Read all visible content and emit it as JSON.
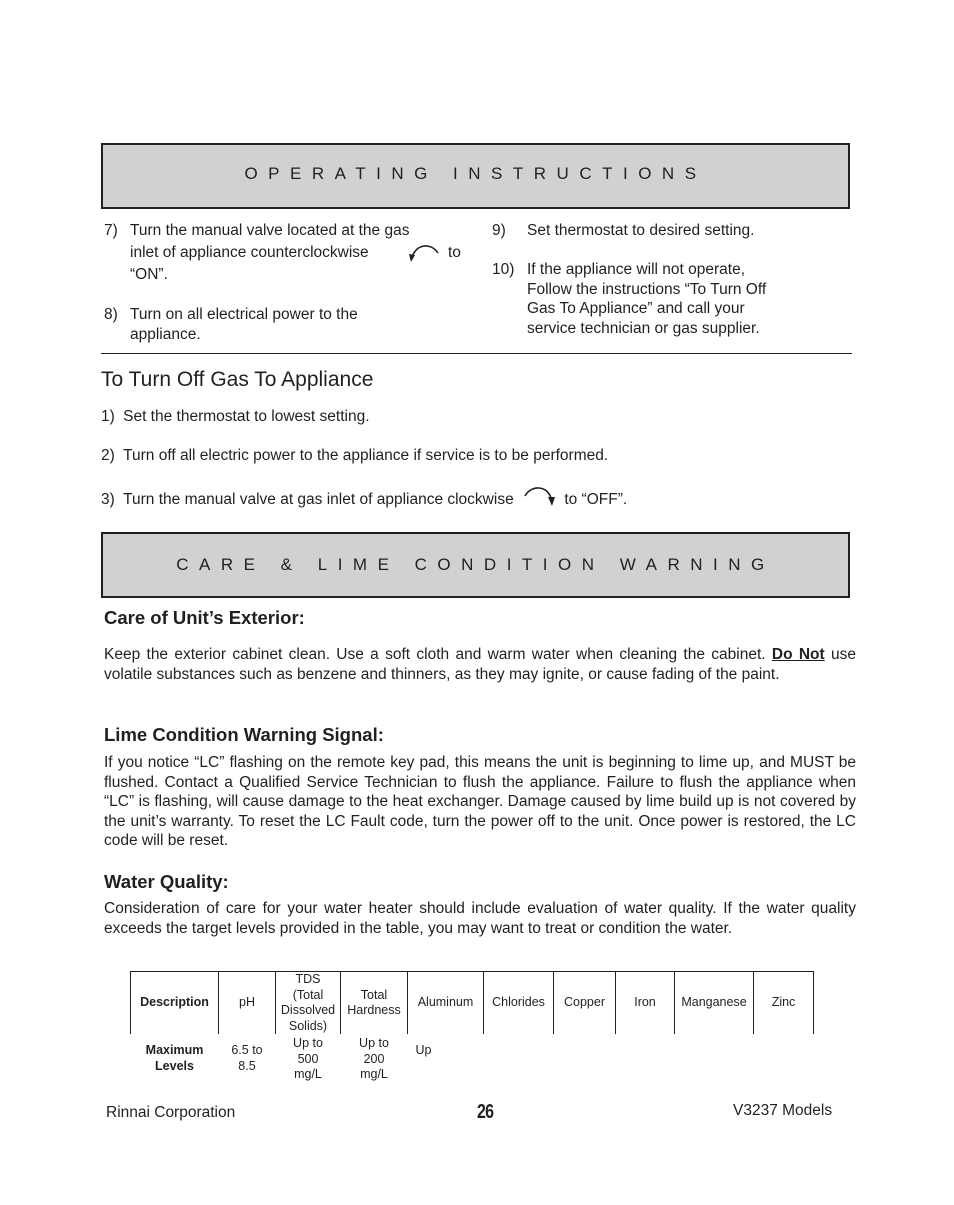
{
  "operating_instructions": {
    "banner_title": "OPERATING INSTRUCTIONS",
    "steps": [
      {
        "num": "7)",
        "lines": [
          "Turn the manual valve located at the gas",
          "inlet of appliance counterclockwise",
          "to",
          "“ON”."
        ],
        "icon": "counterclockwise-arrow-icon"
      },
      {
        "num": "8)",
        "lines": [
          "Turn on all electrical power to the",
          "appliance."
        ]
      },
      {
        "num": "9)",
        "lines": [
          "Set thermostat to desired setting."
        ]
      },
      {
        "num": "10)",
        "lines": [
          "If the appliance will not operate,",
          "Follow the instructions “To Turn Off",
          "Gas To Appliance” and call your",
          "service technician or gas supplier."
        ]
      }
    ]
  },
  "turn_off_gas": {
    "heading": "To Turn Off Gas To Appliance",
    "steps": [
      {
        "num": "1)",
        "text": "Set the thermostat to lowest setting."
      },
      {
        "num": "2)",
        "text": "Turn off all electric power to the appliance if service is to be performed."
      },
      {
        "num": "3)",
        "text": "Turn the manual valve at gas inlet of appliance clockwise",
        "after_icon": "to “OFF”.",
        "icon": "clockwise-arrow-icon"
      }
    ]
  },
  "care_lime": {
    "banner_title": "CARE & LIME CONDITION WARNING",
    "exterior": {
      "heading": "Care of Unit’s Exterior:",
      "text_1": "Keep the exterior cabinet clean. Use a soft cloth and warm water when cleaning the cabinet.",
      "emphasis": "Do Not",
      "text_2": " use volatile substances such as benzene and thinners, as they may ignite, or cause fading of the paint."
    },
    "lime_warning": {
      "heading": "Lime Condition Warning Signal:",
      "text": "If you notice “LC” flashing on the remote key pad, this means the unit is beginning to lime up, and MUST be flushed. Contact a Qualified Service Technician to flush the appliance. Failure to flush the appliance when “LC” is flashing, will cause damage to the heat exchanger. Damage caused by lime build up is not covered by the unit’s warranty. To reset the LC Fault code, turn the power off to the unit. Once power is restored, the LC code will be reset."
    },
    "water_quality": {
      "heading": "Water Quality:",
      "text": "Consideration of care for your water heater should include evaluation of water quality.  If the water quality exceeds the target levels provided in the table, you may want to treat or condition the water.",
      "table": {
        "headers": [
          "Description",
          "pH",
          "TDS\n(Total\nDissolved\nSolids)",
          "Total\nHardness",
          "Aluminum",
          "Chlorides",
          "Copper",
          "Iron",
          "Manganese",
          "Zinc"
        ],
        "row": [
          "Maximum\nLevels",
          "6.5 to\n8.5",
          "Up to\n500\nmg/L",
          "Up to\n200\nmg/L",
          "Up",
          "",
          "",
          "",
          "",
          ""
        ]
      }
    }
  },
  "footer": {
    "left": "Rinnai Corporation",
    "page_number": "26",
    "right": "V3237 Models"
  }
}
